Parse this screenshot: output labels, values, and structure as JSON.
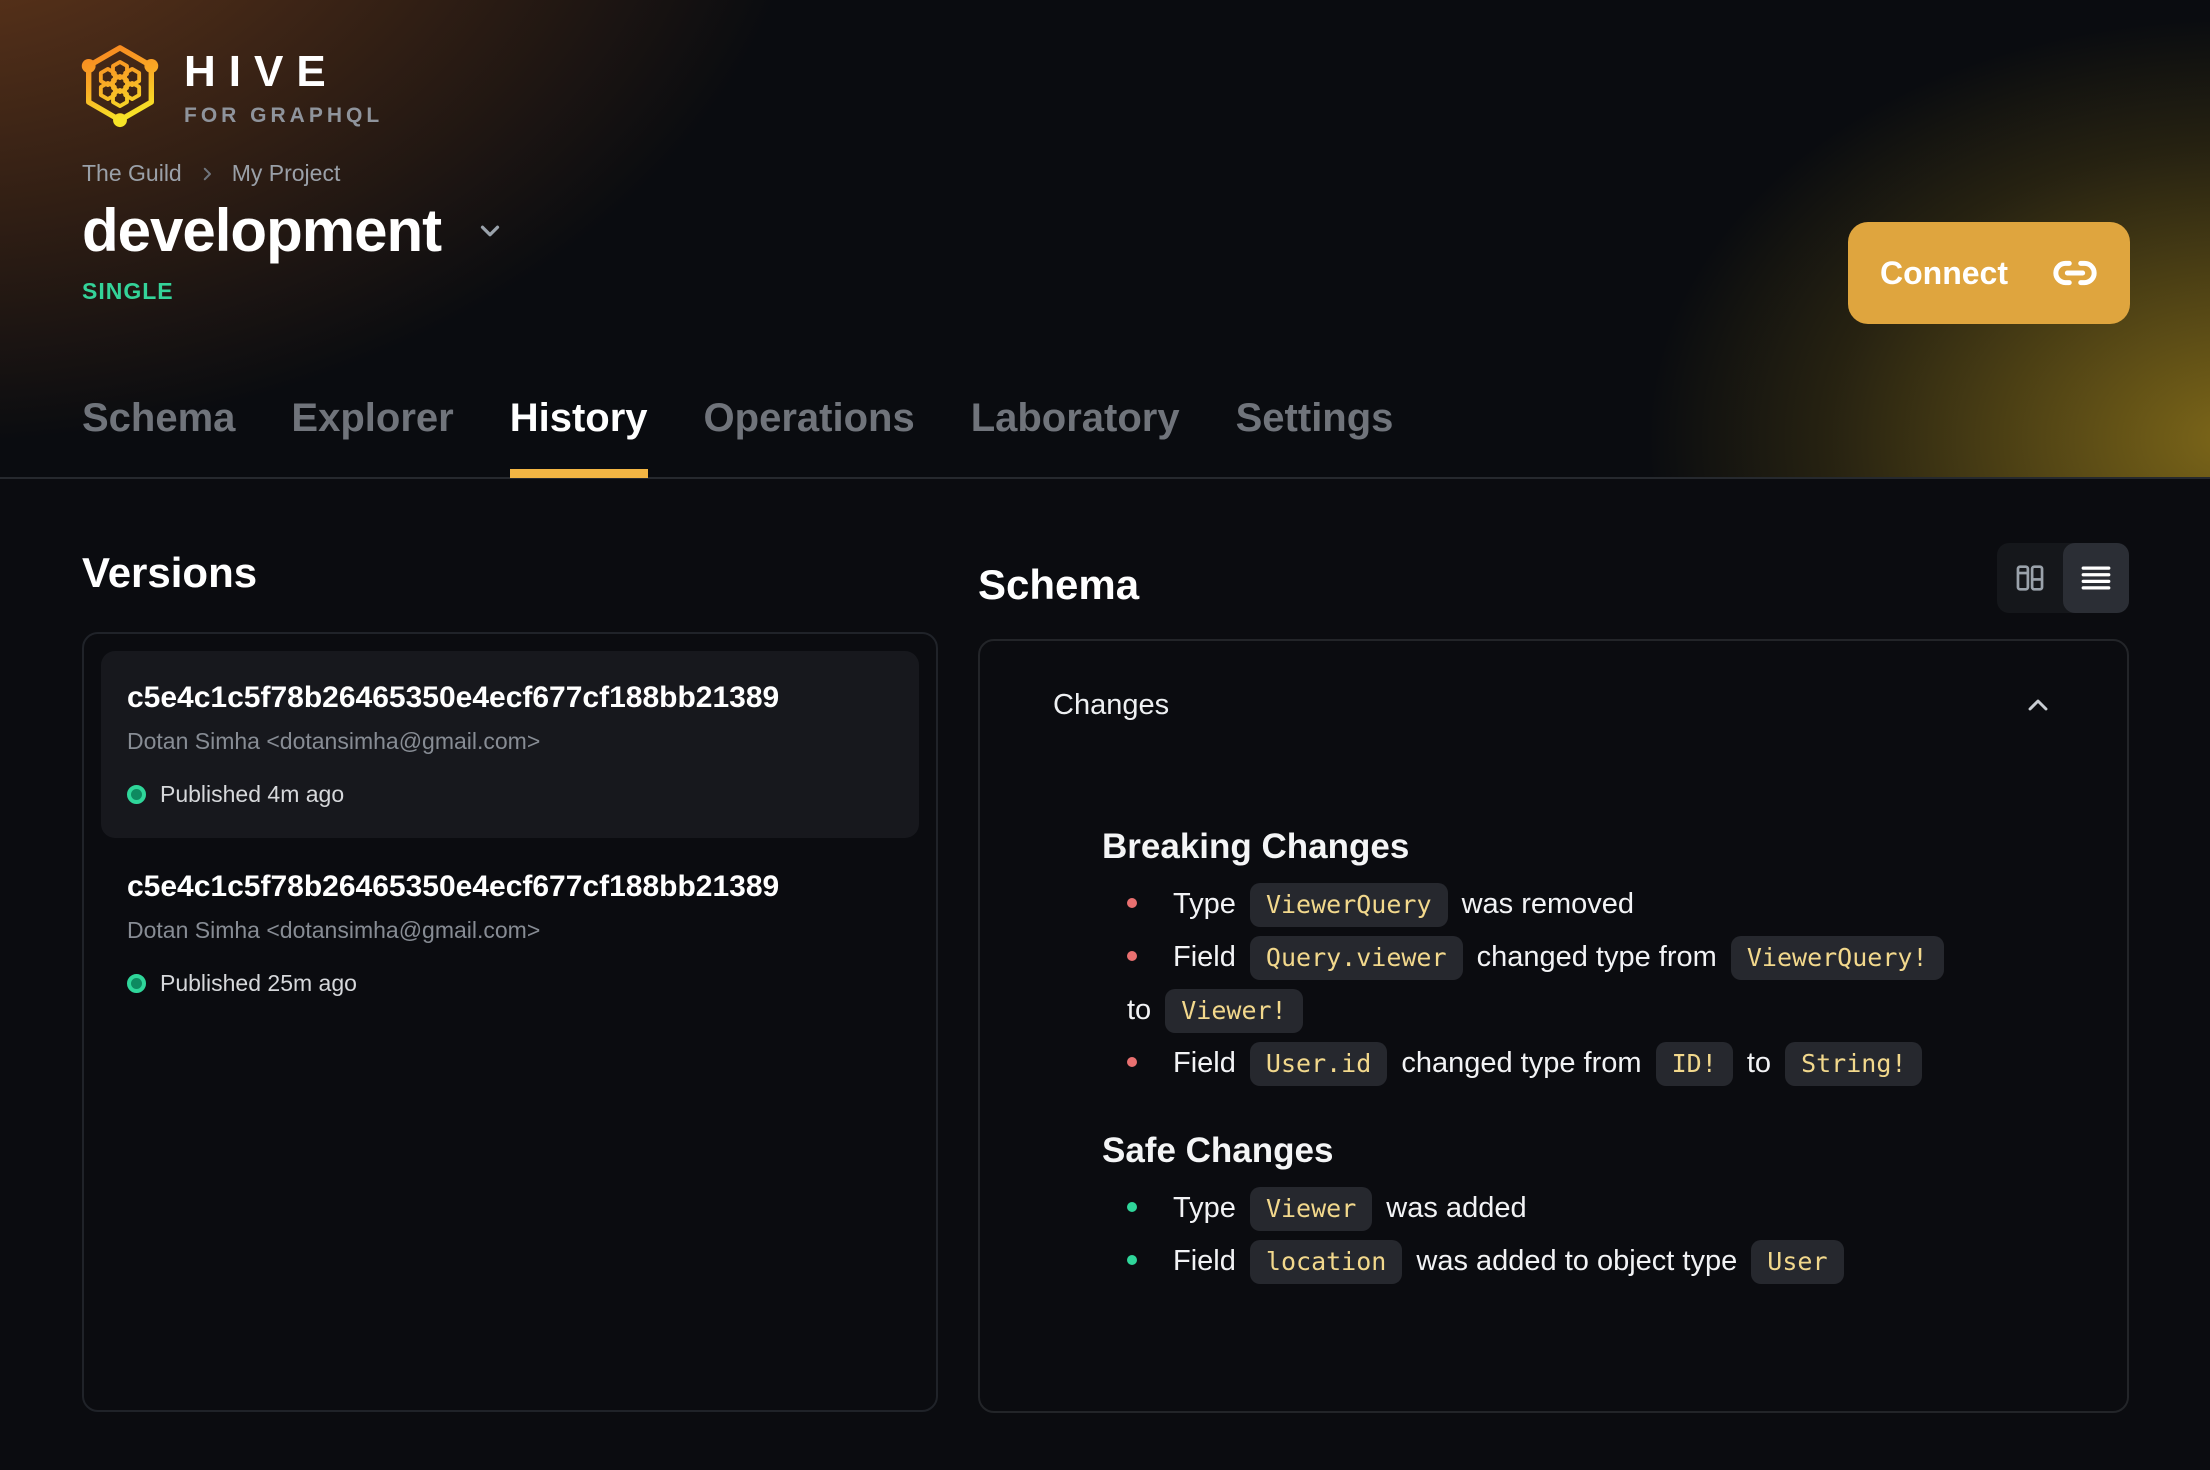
{
  "brand": {
    "name": "HIVE",
    "tagline": "FOR GRAPHQL"
  },
  "breadcrumb": {
    "org": "The Guild",
    "project": "My Project"
  },
  "target": {
    "name": "development",
    "badge": "SINGLE"
  },
  "connect": {
    "label": "Connect"
  },
  "tabs": [
    {
      "label": "Schema",
      "active": false
    },
    {
      "label": "Explorer",
      "active": false
    },
    {
      "label": "History",
      "active": true
    },
    {
      "label": "Operations",
      "active": false
    },
    {
      "label": "Laboratory",
      "active": false
    },
    {
      "label": "Settings",
      "active": false
    }
  ],
  "versions": {
    "heading": "Versions",
    "items": [
      {
        "hash": "c5e4c1c5f78b26465350e4ecf677cf188bb21389",
        "author": "Dotan Simha <dotansimha@gmail.com>",
        "status": "Published 4m ago",
        "selected": true
      },
      {
        "hash": "c5e4c1c5f78b26465350e4ecf677cf188bb21389",
        "author": "Dotan Simha <dotansimha@gmail.com>",
        "status": "Published 25m ago",
        "selected": false
      }
    ]
  },
  "schema_panel": {
    "heading": "Schema",
    "view_toggle": {
      "options": [
        "columns-view",
        "list-view"
      ],
      "active": "list-view"
    },
    "changes": {
      "title": "Changes",
      "groups": [
        {
          "heading": "Breaking Changes",
          "kind": "breaking",
          "items": [
            [
              {
                "t": "Type "
              },
              {
                "c": "ViewerQuery"
              },
              {
                "t": " was removed"
              }
            ],
            [
              {
                "t": "Field "
              },
              {
                "c": "Query.viewer"
              },
              {
                "t": " changed type from "
              },
              {
                "c": "ViewerQuery!"
              },
              {
                "br": true
              },
              {
                "t": "to "
              },
              {
                "c": "Viewer!"
              }
            ],
            [
              {
                "t": "Field "
              },
              {
                "c": "User.id"
              },
              {
                "t": " changed type from "
              },
              {
                "c": "ID!"
              },
              {
                "t": " to "
              },
              {
                "c": "String!"
              }
            ]
          ]
        },
        {
          "heading": "Safe Changes",
          "kind": "safe",
          "items": [
            [
              {
                "t": "Type "
              },
              {
                "c": "Viewer"
              },
              {
                "t": " was added"
              }
            ],
            [
              {
                "t": "Field "
              },
              {
                "c": "location"
              },
              {
                "t": " was added to object type "
              },
              {
                "c": "User"
              }
            ]
          ]
        }
      ]
    }
  },
  "colors": {
    "accent_amber": "#dfa53e",
    "tab_underline": "#f2b544",
    "badge_green": "#34d399",
    "published_dot": "#2fd69a",
    "breaking_bullet": "#e97070",
    "safe_bullet": "#2fd69a",
    "code_text": "#f2d88c",
    "code_bg": "#26282e"
  }
}
